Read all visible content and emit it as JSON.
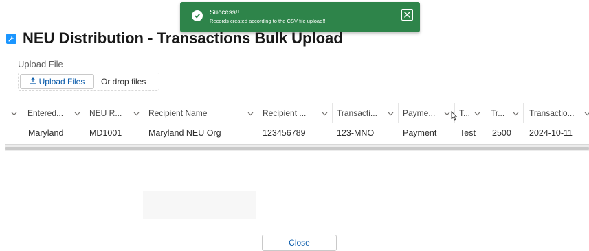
{
  "toast": {
    "title": "Success!!",
    "message": "Records created according to the CSV file upload!!!",
    "check_icon": "check-icon",
    "close_icon": "close-icon",
    "color": "#2e844a"
  },
  "header": {
    "icon": "wrench-icon",
    "title": "NEU Distribution - Transactions Bulk Upload"
  },
  "upload": {
    "label": "Upload File",
    "button_label": "Upload Files",
    "drop_text": "Or drop files",
    "icon": "upload-icon"
  },
  "table": {
    "columns": [
      "Entered...",
      "NEU R...",
      "Recipient Name",
      "Recipient ...",
      "Transacti...",
      "Payme...",
      "T...",
      "Tr...",
      "Transactio..."
    ],
    "rows": [
      [
        "Maryland",
        "MD1001",
        "Maryland NEU Org",
        "123456789",
        "123-MNO",
        "Payment",
        "Test",
        "2500",
        "2024-10-11"
      ]
    ]
  },
  "footer": {
    "close_label": "Close"
  },
  "colors": {
    "brand_blue": "#0b5cab",
    "header_icon": "#1b96ff"
  }
}
